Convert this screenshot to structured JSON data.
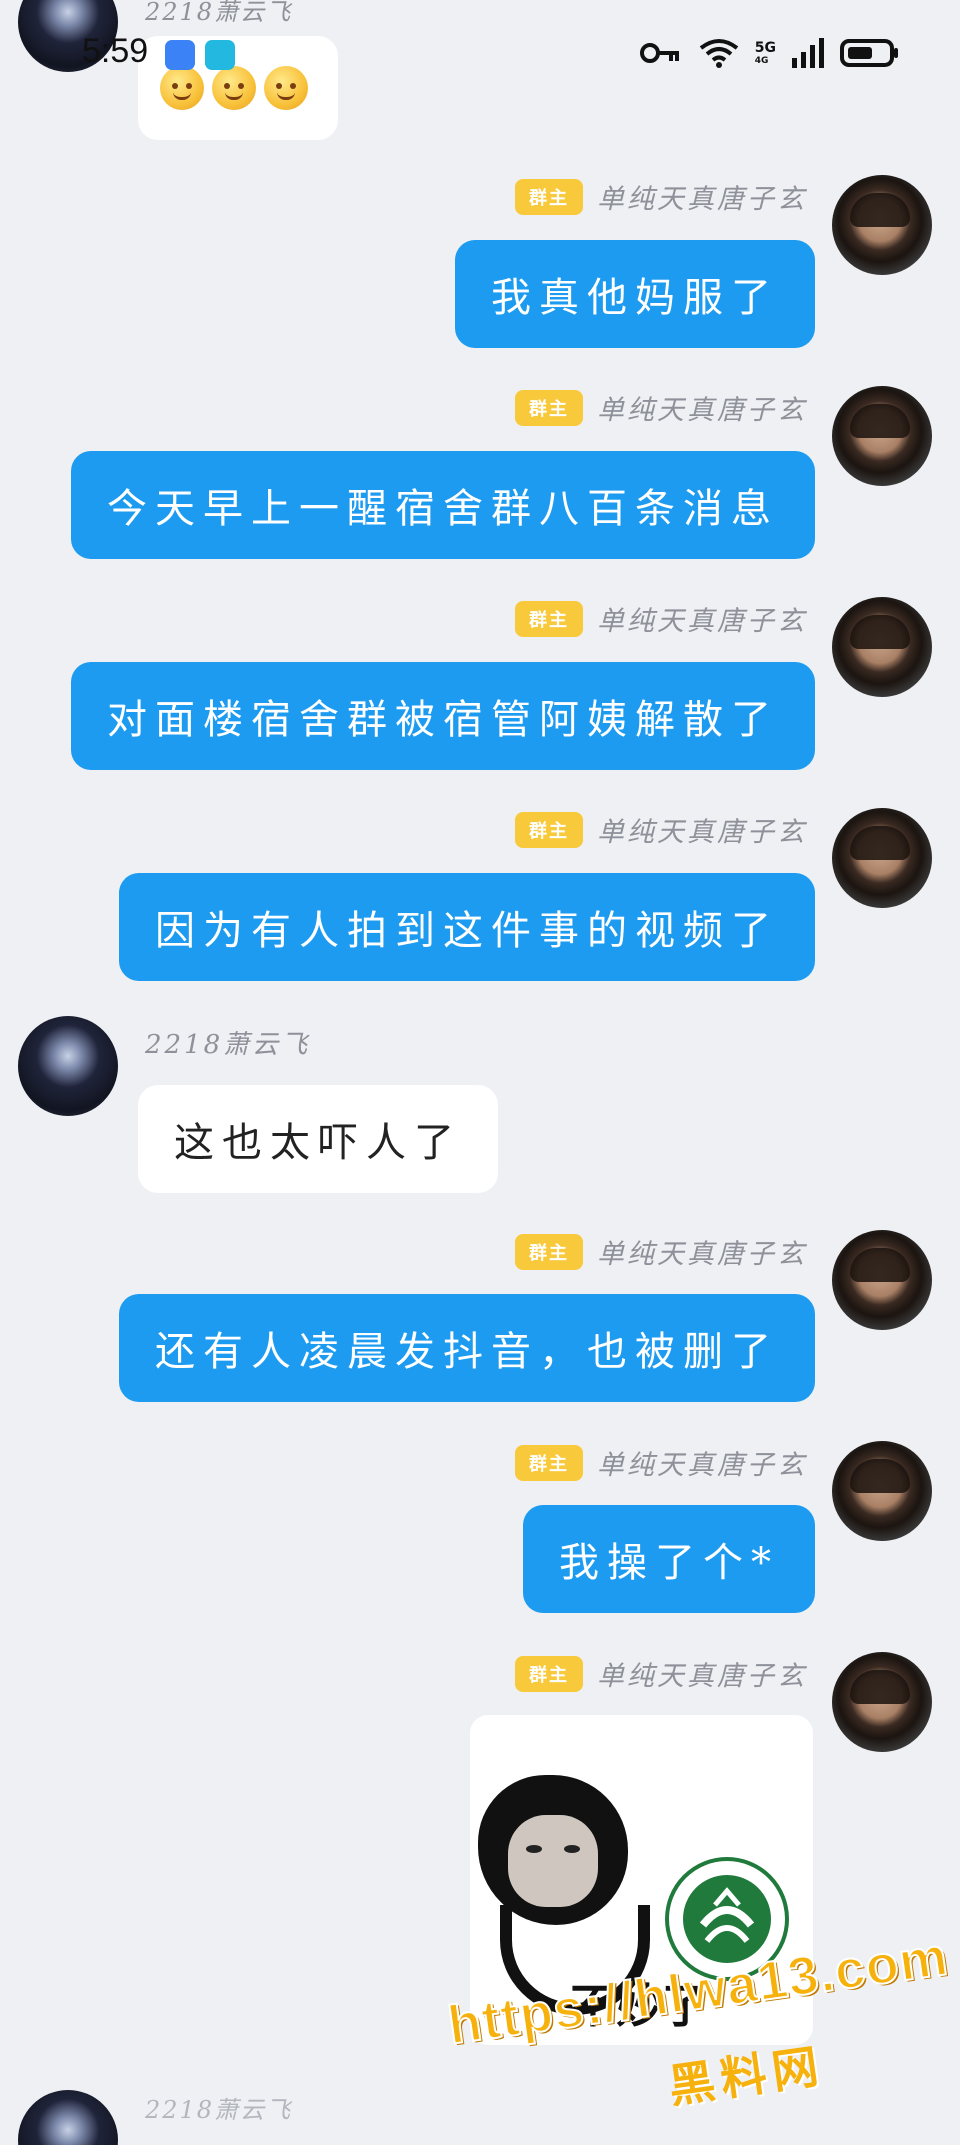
{
  "status_bar": {
    "time": "5:59",
    "network": "5G",
    "network_sub": "4G",
    "battery_level": 0.6
  },
  "messages": [
    {
      "sender": "2218萧云飞",
      "side": "left",
      "type": "emoji",
      "emoji_count": 3
    },
    {
      "sender": "单纯天真唐子玄",
      "role": "群主",
      "side": "right",
      "type": "text",
      "text": "我真他妈服了"
    },
    {
      "sender": "单纯天真唐子玄",
      "role": "群主",
      "side": "right",
      "type": "text",
      "text": "今天早上一醒宿舍群八百条消息"
    },
    {
      "sender": "单纯天真唐子玄",
      "role": "群主",
      "side": "right",
      "type": "text",
      "text": "对面楼宿舍群被宿管阿姨解散了"
    },
    {
      "sender": "单纯天真唐子玄",
      "role": "群主",
      "side": "right",
      "type": "text",
      "text": "因为有人拍到这件事的视频了"
    },
    {
      "sender": "2218萧云飞",
      "side": "left",
      "type": "text",
      "text": "这也太吓人了"
    },
    {
      "sender": "单纯天真唐子玄",
      "role": "群主",
      "side": "right",
      "type": "text",
      "text": "还有人凌晨发抖音，也被删了"
    },
    {
      "sender": "单纯天真唐子玄",
      "role": "群主",
      "side": "right",
      "type": "text",
      "text": "我操了个*"
    },
    {
      "sender": "单纯天真唐子玄",
      "role": "群主",
      "side": "right",
      "type": "sticker",
      "sticker_caption": "不妙了",
      "logo_name": "university-logo"
    }
  ],
  "watermark": {
    "url": "https://hlwa13.com",
    "site": "黑料网"
  },
  "colors": {
    "bubble_blue": "#1c9bf1",
    "bubble_white": "#ffffff",
    "role_badge": "#f9c93c",
    "background": "#eef0f3",
    "watermark": "#f6b10c"
  }
}
